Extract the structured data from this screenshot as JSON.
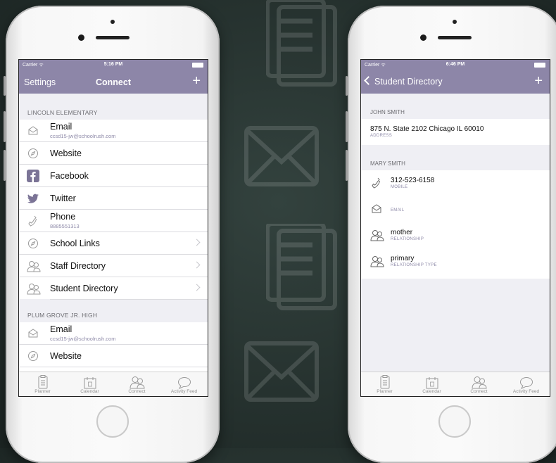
{
  "phone_left": {
    "status": {
      "carrier": "Carrier ᯤ",
      "time": "5:16 PM"
    },
    "nav": {
      "left": "Settings",
      "title": "Connect",
      "plus": "+"
    },
    "sections": [
      {
        "header": "LINCOLN ELEMENTARY",
        "rows": [
          {
            "icon": "envelope-icon",
            "label": "Email",
            "sub": "ccsd15-jw@schoolrush.com"
          },
          {
            "icon": "compass-icon",
            "label": "Website",
            "sub": ""
          },
          {
            "icon": "facebook-icon",
            "label": "Facebook",
            "sub": ""
          },
          {
            "icon": "twitter-icon",
            "label": "Twitter",
            "sub": ""
          },
          {
            "icon": "phone-icon",
            "label": "Phone",
            "sub": "8885551313"
          },
          {
            "icon": "compass-icon",
            "label": "School Links",
            "sub": "",
            "arrow": true
          },
          {
            "icon": "people-icon",
            "label": "Staff Directory",
            "sub": "",
            "arrow": true
          },
          {
            "icon": "people-icon",
            "label": "Student Directory",
            "sub": "",
            "arrow": true
          }
        ]
      },
      {
        "header": "PLUM GROVE JR. HIGH",
        "rows": [
          {
            "icon": "envelope-icon",
            "label": "Email",
            "sub": "ccsd15-jw@schoolrush.com"
          },
          {
            "icon": "compass-icon",
            "label": "Website",
            "sub": ""
          }
        ]
      }
    ],
    "tabs": [
      "Planner",
      "Calendar",
      "Connect",
      "Activity Feed"
    ]
  },
  "phone_right": {
    "status": {
      "carrier": "Carrier ᯤ",
      "time": "6:46 PM"
    },
    "nav": {
      "back": "Student Directory",
      "plus": "+"
    },
    "sections": [
      {
        "header": "JOHN SMITH",
        "rows": [
          {
            "icon": "",
            "value": "875 N. State 2102 Chicago IL 60010",
            "caption": "ADDRESS"
          }
        ]
      },
      {
        "header": "MARY SMITH",
        "rows": [
          {
            "icon": "phone-icon",
            "value": "312-523-6158",
            "caption": "MOBILE"
          },
          {
            "icon": "envelope-icon",
            "value": "",
            "caption": "EMAIL"
          },
          {
            "icon": "people-icon",
            "value": "mother",
            "caption": "RELATIONSHIP"
          },
          {
            "icon": "people-icon",
            "value": "primary",
            "caption": "RELATIONSHIP TYPE"
          }
        ]
      }
    ],
    "tabs": [
      "Planner",
      "Calendar",
      "Connect",
      "Activity Feed"
    ]
  },
  "colors": {
    "nav": "#8d86a8",
    "background": "#26322f",
    "accent_text": "#8e8aa8"
  }
}
